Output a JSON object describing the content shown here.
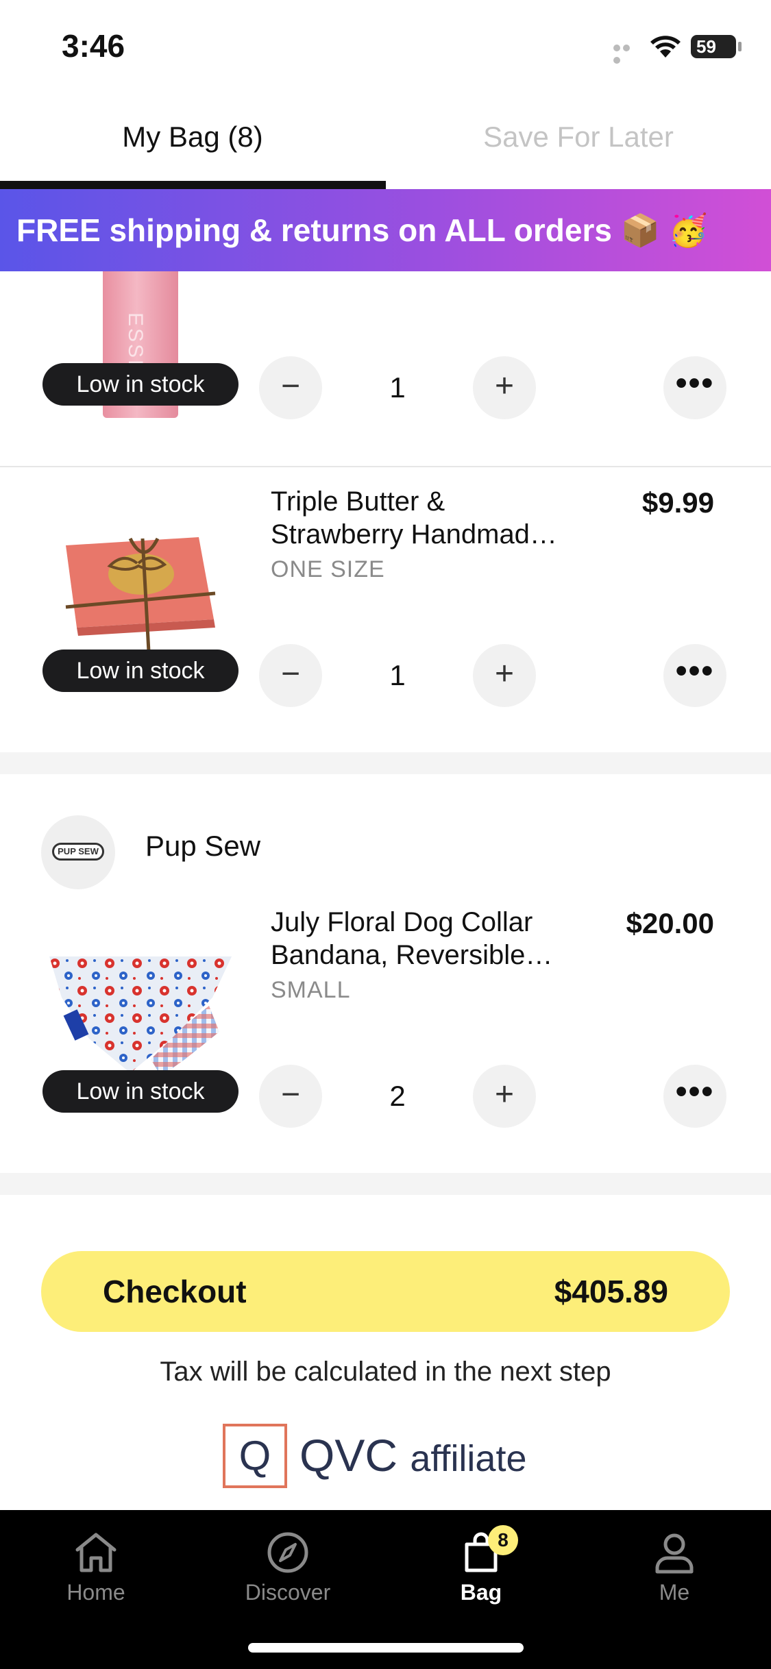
{
  "status_bar": {
    "time": "3:46",
    "battery": "59"
  },
  "tabs": {
    "my_bag": "My Bag (8)",
    "save_for_later": "Save For Later"
  },
  "promo": {
    "text": "FREE shipping & returns on ALL orders 📦 🥳"
  },
  "items": [
    {
      "stock": "Low in stock",
      "quantity": "1",
      "bottle_text": "ESSE"
    },
    {
      "title_line1": "Triple Butter &",
      "title_line2": "Strawberry Handmad…",
      "price": "$9.99",
      "size": "ONE SIZE",
      "stock": "Low in stock",
      "quantity": "1"
    },
    {
      "title_line1": "July Floral Dog Collar",
      "title_line2": "Bandana, Reversible…",
      "price": "$20.00",
      "size": "SMALL",
      "stock": "Low in stock",
      "quantity": "2"
    }
  ],
  "store": {
    "name": "Pup Sew",
    "logo_text": "PUP SEW"
  },
  "qty_controls": {
    "minus": "−",
    "plus": "+",
    "more": "•••"
  },
  "checkout": {
    "label": "Checkout",
    "total": "$405.89",
    "tax_note": "Tax will be calculated in the next step"
  },
  "affiliate": {
    "q": "Q",
    "brand": "QVC",
    "word": "affiliate"
  },
  "tabbar": {
    "home": "Home",
    "discover": "Discover",
    "bag": "Bag",
    "bag_badge": "8",
    "me": "Me"
  },
  "colors": {
    "accent_yellow": "#fdee79",
    "promo_start": "#5a55e8",
    "promo_end": "#d14fd6",
    "pill": "#1c1c1e"
  }
}
